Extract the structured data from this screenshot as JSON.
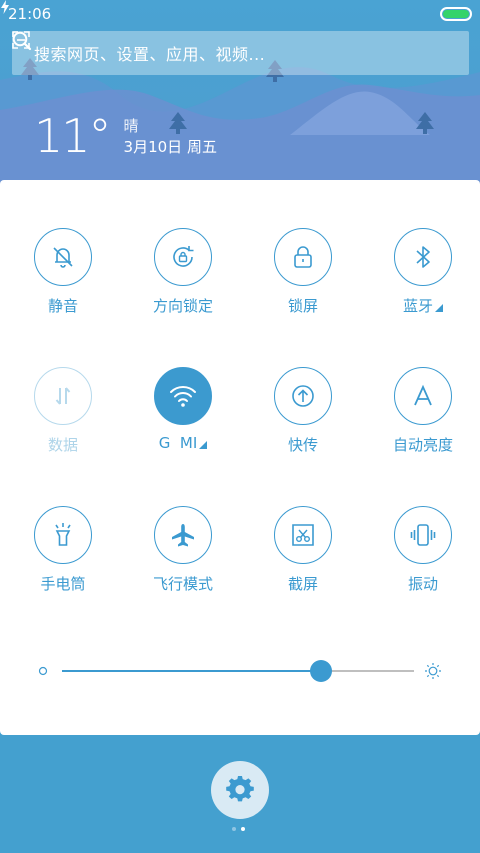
{
  "status": {
    "time": "21:06",
    "battery_level": 1.0
  },
  "search": {
    "placeholder": "搜索网页、设置、应用、视频..."
  },
  "weather": {
    "temperature": "11°",
    "condition": "晴",
    "date": "3月10日 周五"
  },
  "tiles": [
    {
      "label": "静音",
      "icon": "bell-off-icon",
      "state": "normal",
      "has_more": false
    },
    {
      "label": "方向锁定",
      "icon": "rotation-lock-icon",
      "state": "normal",
      "has_more": false
    },
    {
      "label": "锁屏",
      "icon": "padlock-icon",
      "state": "normal",
      "has_more": false
    },
    {
      "label": "蓝牙",
      "icon": "bluetooth-icon",
      "state": "normal",
      "has_more": true
    },
    {
      "label": "数据",
      "icon": "data-arrows-icon",
      "state": "disabled",
      "has_more": false
    },
    {
      "label": "G  MI",
      "icon": "wifi-icon",
      "state": "active",
      "has_more": true
    },
    {
      "label": "快传",
      "icon": "quick-transfer-icon",
      "state": "normal",
      "has_more": false
    },
    {
      "label": "自动亮度",
      "icon": "auto-brightness-icon",
      "state": "normal",
      "has_more": false
    },
    {
      "label": "手电筒",
      "icon": "flashlight-icon",
      "state": "normal",
      "has_more": false
    },
    {
      "label": "飞行模式",
      "icon": "airplane-icon",
      "state": "normal",
      "has_more": false
    },
    {
      "label": "截屏",
      "icon": "screenshot-icon",
      "state": "normal",
      "has_more": false
    },
    {
      "label": "振动",
      "icon": "vibrate-icon",
      "state": "normal",
      "has_more": false
    }
  ],
  "brightness": {
    "level": 0.735
  },
  "pager": {
    "pages": 2,
    "current": 2
  },
  "colors": {
    "accent": "#3b9ad0",
    "battery": "#34d36a",
    "background": "#44a0cf"
  }
}
